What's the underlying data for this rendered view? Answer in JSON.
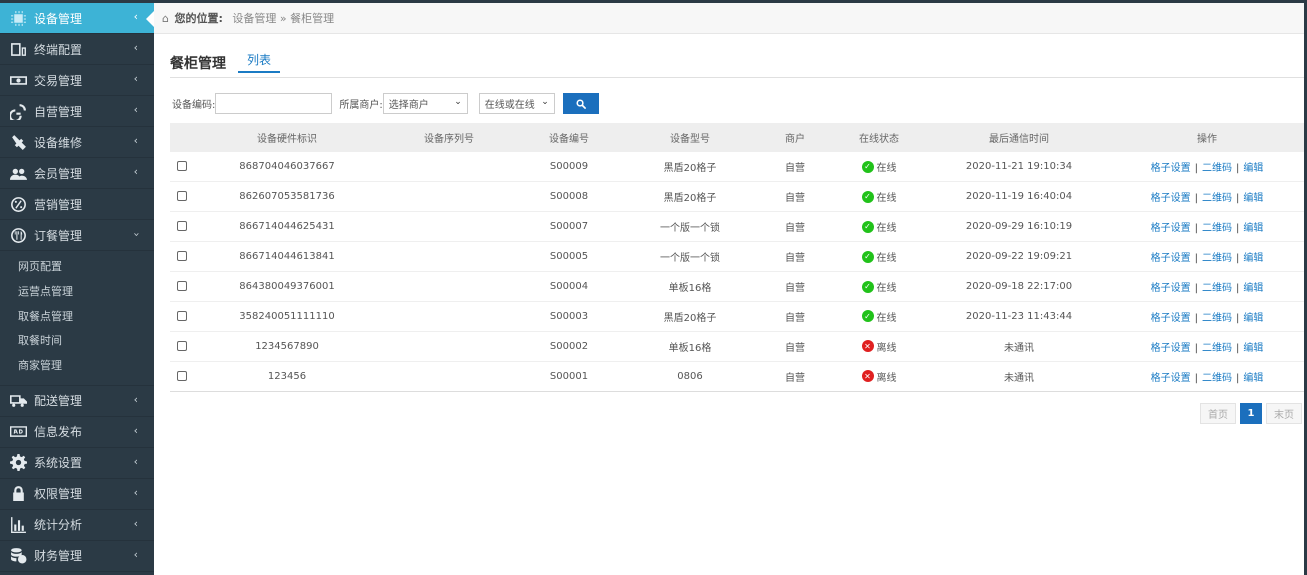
{
  "sidebar": {
    "items": [
      {
        "label": "设备管理",
        "icon": "chip-icon",
        "active": true
      },
      {
        "label": "终端配置",
        "icon": "devices-icon"
      },
      {
        "label": "交易管理",
        "icon": "money-icon"
      },
      {
        "label": "自营管理",
        "icon": "link-icon"
      },
      {
        "label": "设备维修",
        "icon": "tools-icon"
      },
      {
        "label": "会员管理",
        "icon": "users-icon"
      },
      {
        "label": "营销管理",
        "icon": "percent-icon"
      },
      {
        "label": "订餐管理",
        "icon": "fork-knife-icon",
        "expanded": true
      },
      {
        "label": "配送管理",
        "icon": "truck-icon"
      },
      {
        "label": "信息发布",
        "icon": "ad-icon"
      },
      {
        "label": "系统设置",
        "icon": "gear-icon"
      },
      {
        "label": "权限管理",
        "icon": "lock-icon"
      },
      {
        "label": "统计分析",
        "icon": "bar-chart-icon"
      },
      {
        "label": "财务管理",
        "icon": "finance-icon"
      }
    ],
    "sub_items": [
      "网页配置",
      "运营点管理",
      "取餐点管理",
      "取餐时间",
      "商家管理"
    ]
  },
  "breadcrumb": {
    "label": "您的位置:",
    "path": "设备管理 » 餐柜管理"
  },
  "page_title": "餐柜管理",
  "tab": "列表",
  "filters": {
    "device_code_label": "设备编码:",
    "merchant_label": "所属商户:",
    "merchant_value": "选择商户",
    "status_value": "在线或在线"
  },
  "table": {
    "headers": [
      "",
      "设备硬件标识",
      "设备序列号",
      "设备编号",
      "设备型号",
      "商户",
      "在线状态",
      "最后通信时间",
      "操作"
    ],
    "rows": [
      {
        "hw": "868704046037667",
        "serial": "",
        "code": "S00009",
        "model": "黑盾20格子",
        "merchant": "自营",
        "status": "在线",
        "online": true,
        "time": "2020-11-21 19:10:34"
      },
      {
        "hw": "862607053581736",
        "serial": "",
        "code": "S00008",
        "model": "黑盾20格子",
        "merchant": "自营",
        "status": "在线",
        "online": true,
        "time": "2020-11-19 16:40:04"
      },
      {
        "hw": "866714044625431",
        "serial": "",
        "code": "S00007",
        "model": "一个版一个锁",
        "merchant": "自营",
        "status": "在线",
        "online": true,
        "time": "2020-09-29 16:10:19"
      },
      {
        "hw": "866714044613841",
        "serial": "",
        "code": "S00005",
        "model": "一个版一个锁",
        "merchant": "自营",
        "status": "在线",
        "online": true,
        "time": "2020-09-22 19:09:21"
      },
      {
        "hw": "864380049376001",
        "serial": "",
        "code": "S00004",
        "model": "单板16格",
        "merchant": "自营",
        "status": "在线",
        "online": true,
        "time": "2020-09-18 22:17:00"
      },
      {
        "hw": "358240051111110",
        "serial": "",
        "code": "S00003",
        "model": "黑盾20格子",
        "merchant": "自营",
        "status": "在线",
        "online": true,
        "time": "2020-11-23 11:43:44"
      },
      {
        "hw": "1234567890",
        "serial": "",
        "code": "S00002",
        "model": "单板16格",
        "merchant": "自营",
        "status": "离线",
        "online": false,
        "time": "未通讯"
      },
      {
        "hw": "123456",
        "serial": "",
        "code": "S00001",
        "model": "0806",
        "merchant": "自营",
        "status": "离线",
        "online": false,
        "time": "未通讯"
      }
    ],
    "ops": [
      "格子设置",
      "二维码",
      "编辑"
    ]
  },
  "pager": {
    "first": "首页",
    "current": "1",
    "last": "末页"
  },
  "colors": {
    "sidebar_bg": "#2b3a45",
    "sidebar_active": "#3db3d6",
    "accent": "#1b6fbd",
    "online": "#21c21a",
    "offline": "#e02020"
  }
}
